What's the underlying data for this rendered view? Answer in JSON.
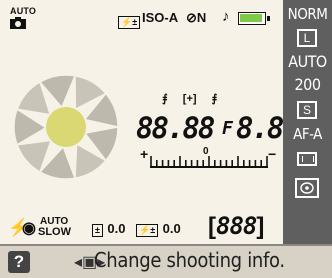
{
  "top_row": {
    "mode_label": "AUTO",
    "flash_comp_icon_label": "",
    "iso_label": "ISO-A",
    "wb_label": "N",
    "battery_label": ""
  },
  "readout": {
    "shutter": "88.88",
    "f_symbol": "F",
    "aperture": "8.8",
    "meter_plus": "+",
    "meter_minus": "−",
    "meter_zero": "0"
  },
  "bottom_row": {
    "flash_mode": "AUTO",
    "flash_slow": "SLOW",
    "exp_comp": "0.0",
    "flash_comp": "0.0",
    "frames": "888"
  },
  "right_column": {
    "quality": "NORM",
    "size": "L",
    "wb": "AUTO",
    "iso": "200",
    "release_mode": "S",
    "af_mode": "AF-A"
  },
  "help": {
    "q_label": "?",
    "text": "Change shooting info."
  },
  "colors": {
    "lcd_background": "#f7f2e8",
    "panel": "#5f5f5f",
    "help_bar": "#d8d2c6",
    "aperture_ring": "#c8c4b8",
    "aperture_center": "#d9d873",
    "battery_green": "#7ec84a"
  }
}
